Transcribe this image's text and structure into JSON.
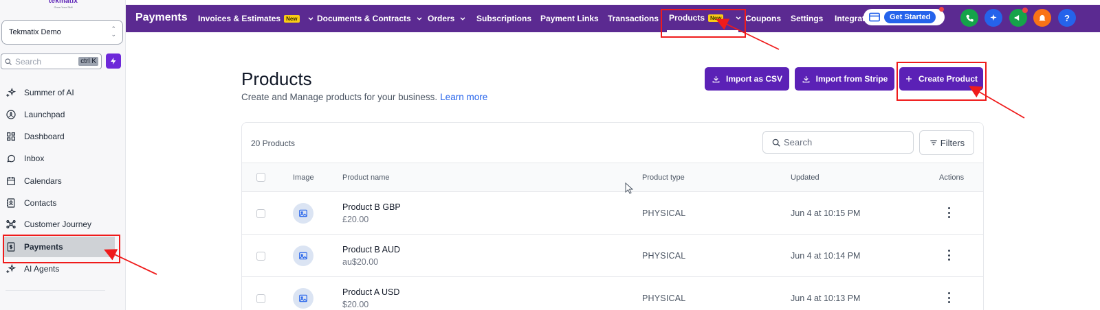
{
  "brand": {
    "name": "tekmatix",
    "tagline": "Grow Your Skill"
  },
  "account": {
    "name": "Tekmatix Demo"
  },
  "sidebar_search": {
    "placeholder": "Search",
    "shortcut": "ctrl K"
  },
  "sidebar": {
    "items": [
      {
        "label": "Summer of AI",
        "icon": "sparkle-icon"
      },
      {
        "label": "Launchpad",
        "icon": "rocket-icon"
      },
      {
        "label": "Dashboard",
        "icon": "dashboard-icon"
      },
      {
        "label": "Inbox",
        "icon": "chat-icon"
      },
      {
        "label": "Calendars",
        "icon": "calendar-icon"
      },
      {
        "label": "Contacts",
        "icon": "contacts-icon"
      },
      {
        "label": "Customer Journey",
        "icon": "journey-icon"
      },
      {
        "label": "Payments",
        "icon": "payments-icon",
        "active": true
      },
      {
        "label": "AI Agents",
        "icon": "sparkle-icon"
      }
    ]
  },
  "topbar": {
    "title": "Payments",
    "tabs": [
      {
        "label": "Invoices & Estimates",
        "badge": "New",
        "dropdown": true
      },
      {
        "label": "Documents & Contracts",
        "dropdown": true
      },
      {
        "label": "Orders",
        "dropdown": true
      },
      {
        "label": "Subscriptions"
      },
      {
        "label": "Payment Links"
      },
      {
        "label": "Transactions"
      },
      {
        "label": "Products",
        "badge": "New",
        "dropdown": true,
        "active": true
      },
      {
        "label": "Coupons"
      },
      {
        "label": "Settings"
      },
      {
        "label": "Integrati"
      }
    ],
    "get_started": "Get Started",
    "help": "?"
  },
  "page": {
    "title": "Products",
    "subtitle": "Create and Manage products for your business.",
    "learn_more": "Learn more",
    "buttons": {
      "import_csv": "Import as CSV",
      "import_stripe": "Import from Stripe",
      "create": "Create Product"
    }
  },
  "table": {
    "count_label": "20 Products",
    "search_placeholder": "Search",
    "filters_label": "Filters",
    "columns": [
      "Image",
      "Product name",
      "Product type",
      "Updated",
      "Actions"
    ],
    "rows": [
      {
        "name": "Product B GBP",
        "price": "£20.00",
        "type": "PHYSICAL",
        "updated": "Jun 4 at 10:15 PM"
      },
      {
        "name": "Product B AUD",
        "price": "au$20.00",
        "type": "PHYSICAL",
        "updated": "Jun 4 at 10:14 PM"
      },
      {
        "name": "Product A USD",
        "price": "$20.00",
        "type": "PHYSICAL",
        "updated": "Jun 4 at 10:13 PM"
      }
    ]
  },
  "colors": {
    "topbar": "#5b2a91",
    "primary_button": "#5b21b6",
    "annotation": "#ef1b1b",
    "new_badge": "#facc15"
  }
}
